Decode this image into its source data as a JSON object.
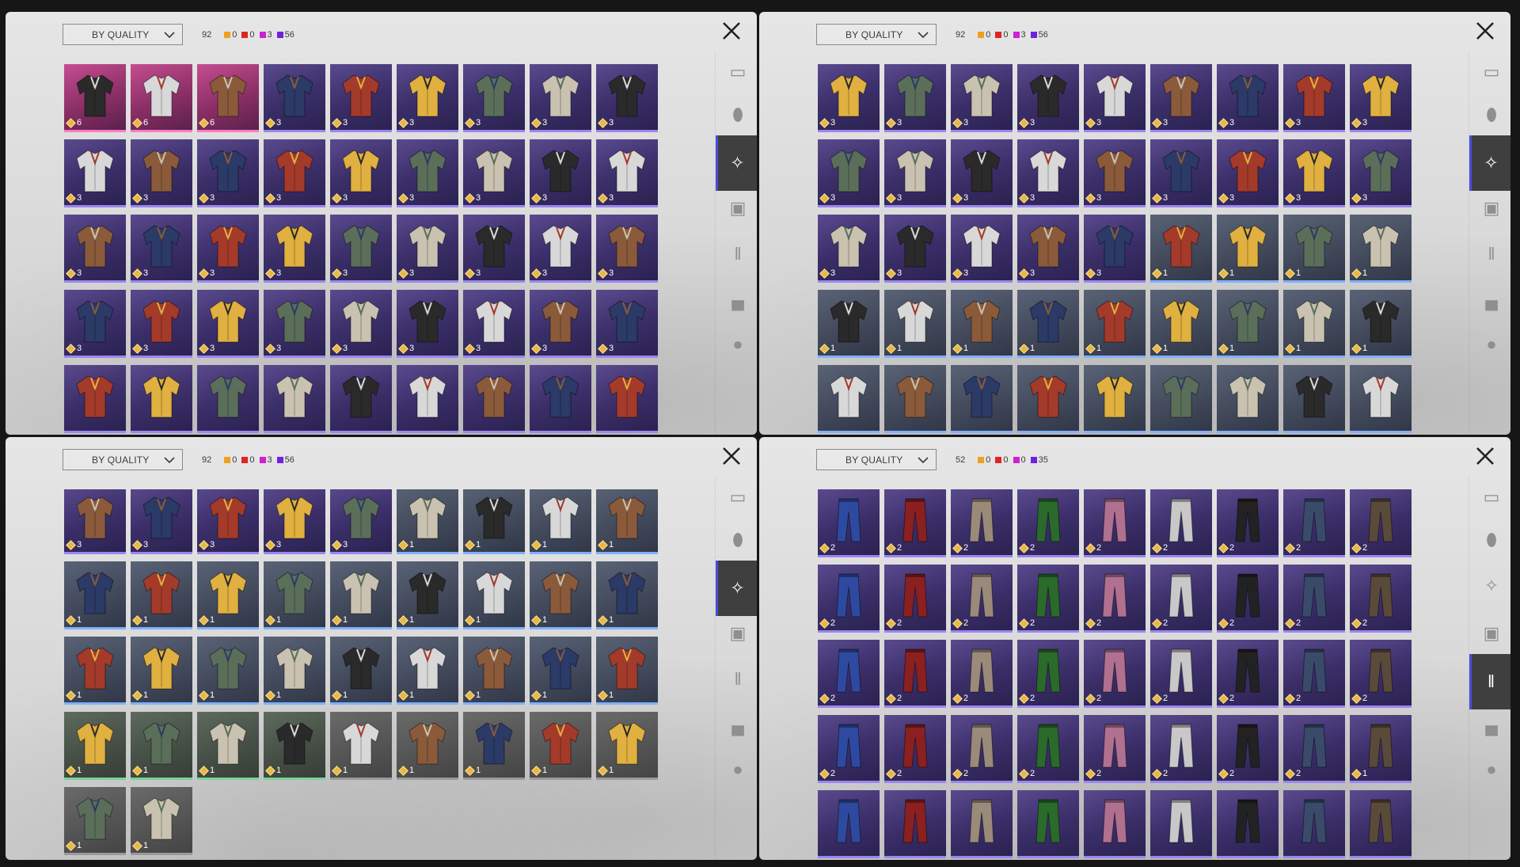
{
  "colors": {
    "legendary": "#c54d91",
    "epic": "#3c2f6a",
    "rare": "#424a5c",
    "uncommon": "#465046",
    "common": "#555555",
    "count_orange": "#f0a020",
    "count_red": "#e02424",
    "count_magenta": "#d020d0",
    "count_purple": "#7020e0",
    "active_tab_bg": "#3f3f3f"
  },
  "sidebar_icons": [
    "goggles-icon",
    "mask-icon",
    "shirt-icon",
    "vest-icon",
    "pants-icon",
    "boots-icon",
    "gloves-icon"
  ],
  "panels": [
    {
      "filter_label": "BY QUALITY",
      "total": "92",
      "counts": [
        "0",
        "0",
        "3",
        "56"
      ],
      "active_tab": 2,
      "item_type": "top",
      "rows": [
        [
          [
            "legendary",
            "6"
          ],
          [
            "legendary",
            "6"
          ],
          [
            "legendary",
            "6"
          ],
          [
            "epic",
            "3"
          ],
          [
            "epic",
            "3"
          ],
          [
            "epic",
            "3"
          ],
          [
            "epic",
            "3"
          ],
          [
            "epic",
            "3"
          ],
          [
            "epic",
            "3"
          ]
        ],
        [
          [
            "epic",
            "3"
          ],
          [
            "epic",
            "3"
          ],
          [
            "epic",
            "3"
          ],
          [
            "epic",
            "3"
          ],
          [
            "epic",
            "3"
          ],
          [
            "epic",
            "3"
          ],
          [
            "epic",
            "3"
          ],
          [
            "epic",
            "3"
          ],
          [
            "epic",
            "3"
          ]
        ],
        [
          [
            "epic",
            "3"
          ],
          [
            "epic",
            "3"
          ],
          [
            "epic",
            "3"
          ],
          [
            "epic",
            "3"
          ],
          [
            "epic",
            "3"
          ],
          [
            "epic",
            "3"
          ],
          [
            "epic",
            "3"
          ],
          [
            "epic",
            "3"
          ],
          [
            "epic",
            "3"
          ]
        ],
        [
          [
            "epic",
            "3"
          ],
          [
            "epic",
            "3"
          ],
          [
            "epic",
            "3"
          ],
          [
            "epic",
            "3"
          ],
          [
            "epic",
            "3"
          ],
          [
            "epic",
            "3"
          ],
          [
            "epic",
            "3"
          ],
          [
            "epic",
            "3"
          ],
          [
            "epic",
            "3"
          ]
        ],
        [
          [
            "epic",
            ""
          ],
          [
            "epic",
            ""
          ],
          [
            "epic",
            ""
          ],
          [
            "epic",
            ""
          ],
          [
            "epic",
            ""
          ],
          [
            "epic",
            ""
          ],
          [
            "epic",
            ""
          ],
          [
            "epic",
            ""
          ],
          [
            "epic",
            ""
          ]
        ]
      ]
    },
    {
      "filter_label": "BY QUALITY",
      "total": "92",
      "counts": [
        "0",
        "0",
        "3",
        "56"
      ],
      "active_tab": 2,
      "item_type": "top",
      "rows": [
        [
          [
            "epic",
            "3"
          ],
          [
            "epic",
            "3"
          ],
          [
            "epic",
            "3"
          ],
          [
            "epic",
            "3"
          ],
          [
            "epic",
            "3"
          ],
          [
            "epic",
            "3"
          ],
          [
            "epic",
            "3"
          ],
          [
            "epic",
            "3"
          ],
          [
            "epic",
            "3"
          ]
        ],
        [
          [
            "epic",
            "3"
          ],
          [
            "epic",
            "3"
          ],
          [
            "epic",
            "3"
          ],
          [
            "epic",
            "3"
          ],
          [
            "epic",
            "3"
          ],
          [
            "epic",
            "3"
          ],
          [
            "epic",
            "3"
          ],
          [
            "epic",
            "3"
          ],
          [
            "epic",
            "3"
          ]
        ],
        [
          [
            "epic",
            "3"
          ],
          [
            "epic",
            "3"
          ],
          [
            "epic",
            "3"
          ],
          [
            "epic",
            "3"
          ],
          [
            "epic",
            "3"
          ],
          [
            "rare",
            "1"
          ],
          [
            "rare",
            "1"
          ],
          [
            "rare",
            "1"
          ],
          [
            "rare",
            "1"
          ]
        ],
        [
          [
            "rare",
            "1"
          ],
          [
            "rare",
            "1"
          ],
          [
            "rare",
            "1"
          ],
          [
            "rare",
            "1"
          ],
          [
            "rare",
            "1"
          ],
          [
            "rare",
            "1"
          ],
          [
            "rare",
            "1"
          ],
          [
            "rare",
            "1"
          ],
          [
            "rare",
            "1"
          ]
        ],
        [
          [
            "rare",
            ""
          ],
          [
            "rare",
            ""
          ],
          [
            "rare",
            ""
          ],
          [
            "rare",
            ""
          ],
          [
            "rare",
            ""
          ],
          [
            "rare",
            ""
          ],
          [
            "rare",
            ""
          ],
          [
            "rare",
            ""
          ],
          [
            "rare",
            ""
          ]
        ]
      ]
    },
    {
      "filter_label": "BY QUALITY",
      "total": "92",
      "counts": [
        "0",
        "0",
        "3",
        "56"
      ],
      "active_tab": 2,
      "item_type": "top",
      "rows": [
        [
          [
            "epic",
            "3"
          ],
          [
            "epic",
            "3"
          ],
          [
            "epic",
            "3"
          ],
          [
            "epic",
            "3"
          ],
          [
            "epic",
            "3"
          ],
          [
            "rare",
            "1"
          ],
          [
            "rare",
            "1"
          ],
          [
            "rare",
            "1"
          ],
          [
            "rare",
            "1"
          ]
        ],
        [
          [
            "rare",
            "1"
          ],
          [
            "rare",
            "1"
          ],
          [
            "rare",
            "1"
          ],
          [
            "rare",
            "1"
          ],
          [
            "rare",
            "1"
          ],
          [
            "rare",
            "1"
          ],
          [
            "rare",
            "1"
          ],
          [
            "rare",
            "1"
          ],
          [
            "rare",
            "1"
          ]
        ],
        [
          [
            "rare",
            "1"
          ],
          [
            "rare",
            "1"
          ],
          [
            "rare",
            "1"
          ],
          [
            "rare",
            "1"
          ],
          [
            "rare",
            "1"
          ],
          [
            "rare",
            "1"
          ],
          [
            "rare",
            "1"
          ],
          [
            "rare",
            "1"
          ],
          [
            "rare",
            "1"
          ]
        ],
        [
          [
            "uncommon",
            "1"
          ],
          [
            "uncommon",
            "1"
          ],
          [
            "uncommon",
            "1"
          ],
          [
            "uncommon",
            "1"
          ],
          [
            "common",
            "1"
          ],
          [
            "common",
            "1"
          ],
          [
            "common",
            "1"
          ],
          [
            "common",
            "1"
          ],
          [
            "common",
            "1"
          ]
        ],
        [
          [
            "common",
            "1"
          ],
          [
            "common",
            "1"
          ]
        ]
      ]
    },
    {
      "filter_label": "BY QUALITY",
      "total": "52",
      "counts": [
        "0",
        "0",
        "0",
        "35"
      ],
      "active_tab": 4,
      "item_type": "pants",
      "rows": [
        [
          [
            "epic",
            "2"
          ],
          [
            "epic",
            "2"
          ],
          [
            "epic",
            "2"
          ],
          [
            "epic",
            "2"
          ],
          [
            "epic",
            "2"
          ],
          [
            "epic",
            "2"
          ],
          [
            "epic",
            "2"
          ],
          [
            "epic",
            "2"
          ],
          [
            "epic",
            "2"
          ]
        ],
        [
          [
            "epic",
            "2"
          ],
          [
            "epic",
            "2"
          ],
          [
            "epic",
            "2"
          ],
          [
            "epic",
            "2"
          ],
          [
            "epic",
            "2"
          ],
          [
            "epic",
            "2"
          ],
          [
            "epic",
            "2"
          ],
          [
            "epic",
            "2"
          ],
          [
            "epic",
            "2"
          ]
        ],
        [
          [
            "epic",
            "2"
          ],
          [
            "epic",
            "2"
          ],
          [
            "epic",
            "2"
          ],
          [
            "epic",
            "2"
          ],
          [
            "epic",
            "2"
          ],
          [
            "epic",
            "2"
          ],
          [
            "epic",
            "2"
          ],
          [
            "epic",
            "2"
          ],
          [
            "epic",
            "2"
          ]
        ],
        [
          [
            "epic",
            "2"
          ],
          [
            "epic",
            "2"
          ],
          [
            "epic",
            "2"
          ],
          [
            "epic",
            "2"
          ],
          [
            "epic",
            "2"
          ],
          [
            "epic",
            "2"
          ],
          [
            "epic",
            "2"
          ],
          [
            "epic",
            "2"
          ],
          [
            "epic",
            "1"
          ]
        ],
        [
          [
            "epic",
            ""
          ],
          [
            "epic",
            ""
          ],
          [
            "epic",
            ""
          ],
          [
            "epic",
            ""
          ],
          [
            "epic",
            ""
          ],
          [
            "epic",
            ""
          ],
          [
            "epic",
            ""
          ],
          [
            "epic",
            ""
          ],
          [
            "epic",
            ""
          ]
        ]
      ]
    }
  ]
}
